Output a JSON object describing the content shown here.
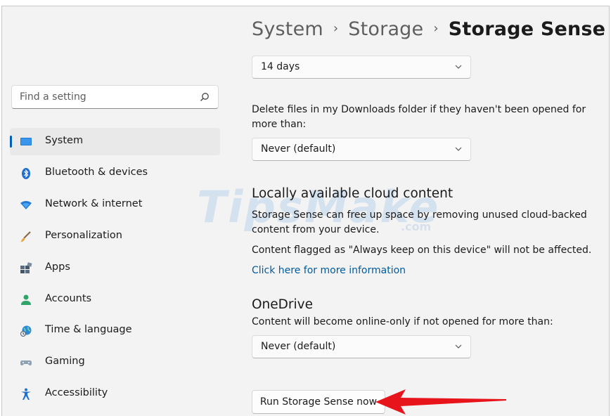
{
  "sidebar": {
    "search_placeholder": "Find a setting",
    "items": [
      {
        "label": "System",
        "icon": "system-icon",
        "selected": true
      },
      {
        "label": "Bluetooth & devices",
        "icon": "bluetooth-icon"
      },
      {
        "label": "Network & internet",
        "icon": "network-icon"
      },
      {
        "label": "Personalization",
        "icon": "brush-icon"
      },
      {
        "label": "Apps",
        "icon": "apps-icon"
      },
      {
        "label": "Accounts",
        "icon": "accounts-icon"
      },
      {
        "label": "Time & language",
        "icon": "globe-clock-icon"
      },
      {
        "label": "Gaming",
        "icon": "gamepad-icon"
      },
      {
        "label": "Accessibility",
        "icon": "accessibility-icon"
      }
    ]
  },
  "breadcrumb": {
    "items": [
      "System",
      "Storage",
      "Storage Sense"
    ],
    "separator": "›"
  },
  "main": {
    "recycle_dropdown": {
      "value": "14 days"
    },
    "downloads_text": "Delete files in my Downloads folder if they haven't been opened for more than:",
    "downloads_dropdown": {
      "value": "Never (default)"
    },
    "cloud_heading": "Locally available cloud content",
    "cloud_desc": "Storage Sense can free up space by removing unused cloud-backed content from your device.",
    "cloud_note": "Content flagged as \"Always keep on this device\" will not be affected.",
    "cloud_link": "Click here for more information",
    "onedrive_heading": "OneDrive",
    "onedrive_text": "Content will become online-only if not opened for more than:",
    "onedrive_dropdown": {
      "value": "Never (default)"
    },
    "run_button": "Run Storage Sense now"
  },
  "watermark": {
    "text": "TipsMake",
    "suffix": ".com"
  },
  "colors": {
    "accent": "#005fb8",
    "link": "#005a9e",
    "arrow": "#e8141b",
    "background": "#f3f3f3"
  }
}
